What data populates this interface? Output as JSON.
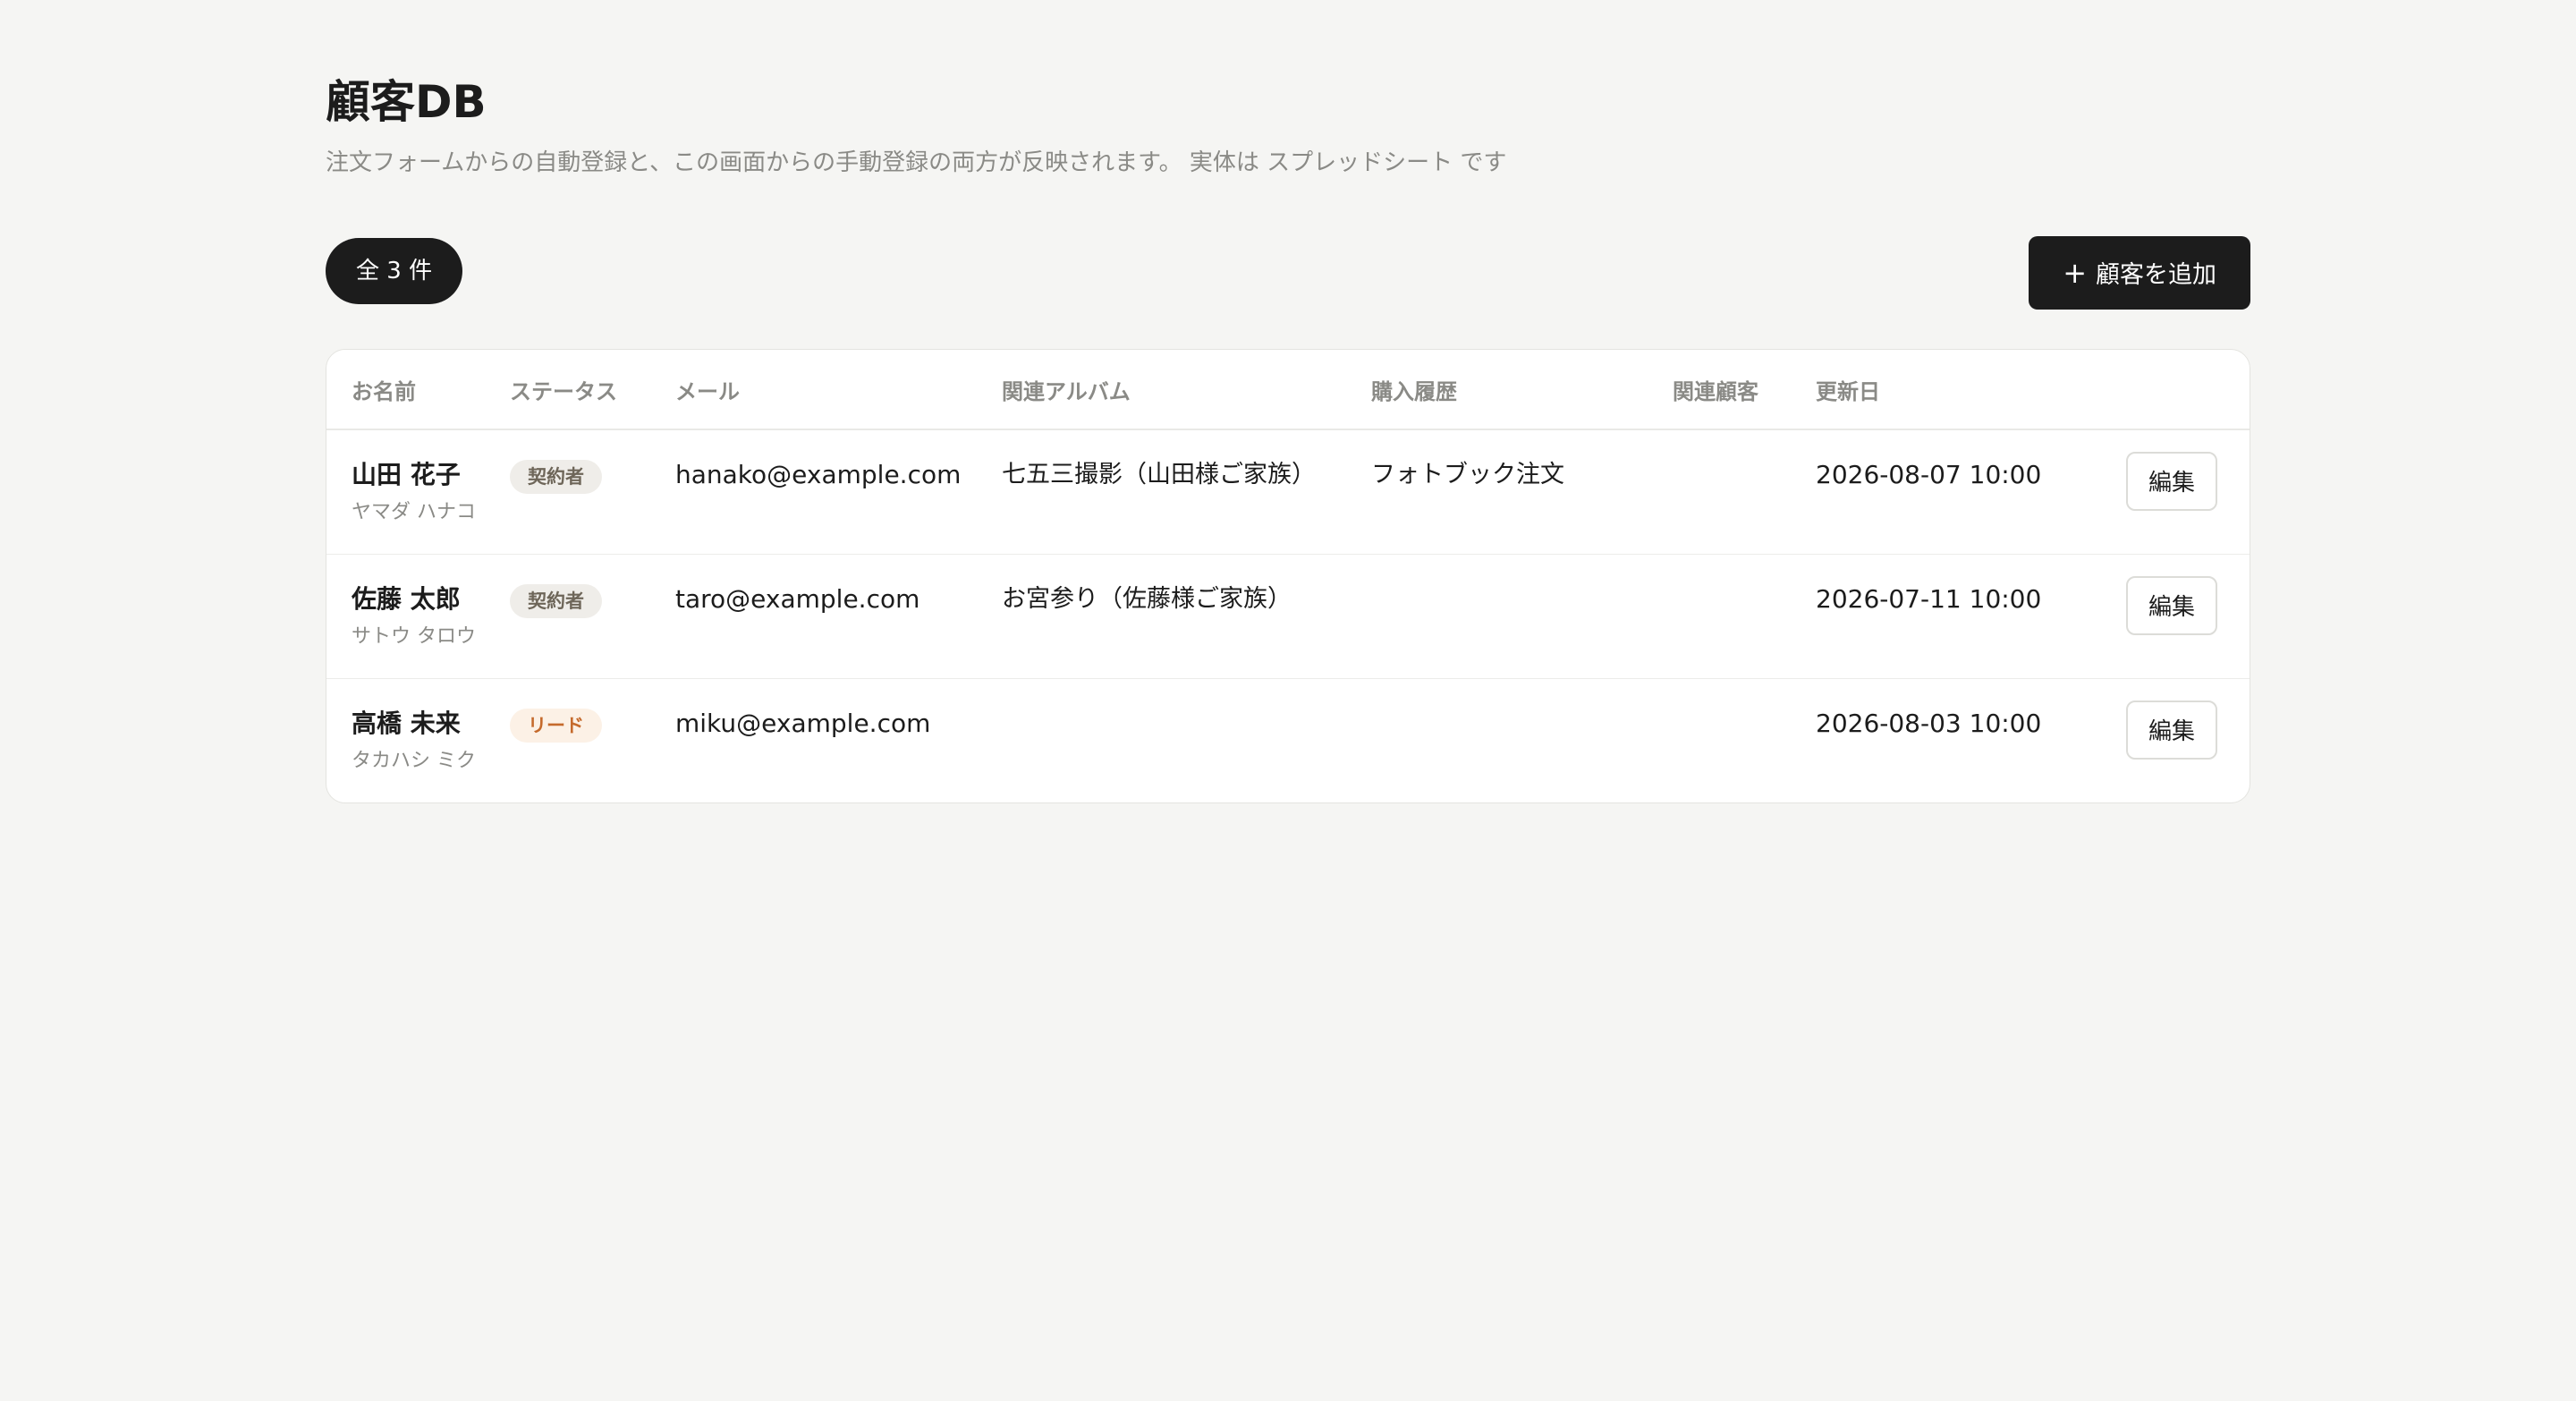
{
  "page": {
    "title": "顧客DB",
    "subtitle": "注文フォームからの自動登録と、この画面からの手動登録の両方が反映されます。 実体は スプレッドシート です"
  },
  "toolbar": {
    "count_label": "全 3 件",
    "add_button_icon": "plus-icon",
    "add_button_label": "顧客を追加"
  },
  "table": {
    "columns": [
      "お名前",
      "ステータス",
      "メール",
      "関連アルバム",
      "購入履歴",
      "関連顧客",
      "更新日",
      ""
    ],
    "rows": [
      {
        "name": "山田 花子",
        "kana": "ヤマダ ハナコ",
        "status": "契約者",
        "status_kind": "contract",
        "email": "hanako@example.com",
        "album": "七五三撮影（山田様ご家族）",
        "purchase": "フォトブック注文",
        "related": "",
        "updated": "2026-08-07 10:00",
        "action": "編集"
      },
      {
        "name": "佐藤 太郎",
        "kana": "サトウ タロウ",
        "status": "契約者",
        "status_kind": "contract",
        "email": "taro@example.com",
        "album": "お宮参り（佐藤様ご家族）",
        "purchase": "",
        "related": "",
        "updated": "2026-07-11 10:00",
        "action": "編集"
      },
      {
        "name": "高橋 未来",
        "kana": "タカハシ ミク",
        "status": "リード",
        "status_kind": "lead",
        "email": "miku@example.com",
        "album": "",
        "purchase": "",
        "related": "",
        "updated": "2026-08-03 10:00",
        "action": "編集"
      }
    ]
  },
  "colors": {
    "background": "#f5f5f3",
    "primary": "#1c1c1c",
    "muted_text": "#8a8a86",
    "badge_contract_bg": "#efede9",
    "badge_contract_text": "#6e6659",
    "badge_lead_bg": "#fcf1e6",
    "badge_lead_text": "#c56a2c"
  }
}
